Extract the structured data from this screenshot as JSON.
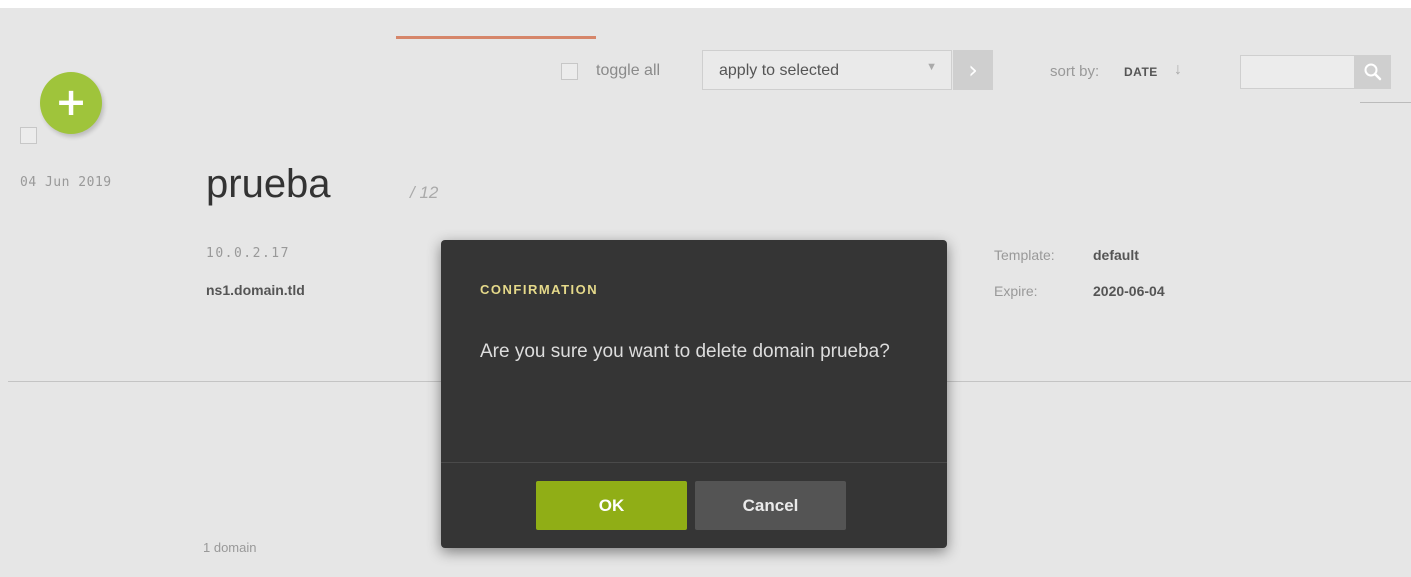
{
  "toolbar": {
    "toggle_all_label": "toggle all",
    "apply_select_value": "apply to selected",
    "sort_by_label": "sort by:",
    "sort_value": "DATE",
    "sort_direction_icon": "↓",
    "search_placeholder": ""
  },
  "icons": {
    "add": "plus-icon",
    "go": "chevron-right-icon",
    "search": "search-icon",
    "select_caret": "caret-down-icon"
  },
  "colors": {
    "accent_green": "#9fc43b",
    "ok_button": "#90ae16",
    "modal_bg": "#353535",
    "modal_title": "#e5d98a",
    "accent_line": "#d6866a"
  },
  "domain_row": {
    "date": "04 Jun 2019",
    "name": "prueba",
    "count": "/ 12",
    "ip": "10.0.2.17",
    "nameserver": "ns1.domain.tld",
    "template_label": "Template:",
    "template_value": "default",
    "expire_label": "Expire:",
    "expire_value": "2020-06-04"
  },
  "footer": {
    "count_text": "1 domain"
  },
  "modal": {
    "title": "CONFIRMATION",
    "message": "Are you sure you want to delete domain prueba?",
    "ok_label": "OK",
    "cancel_label": "Cancel"
  }
}
